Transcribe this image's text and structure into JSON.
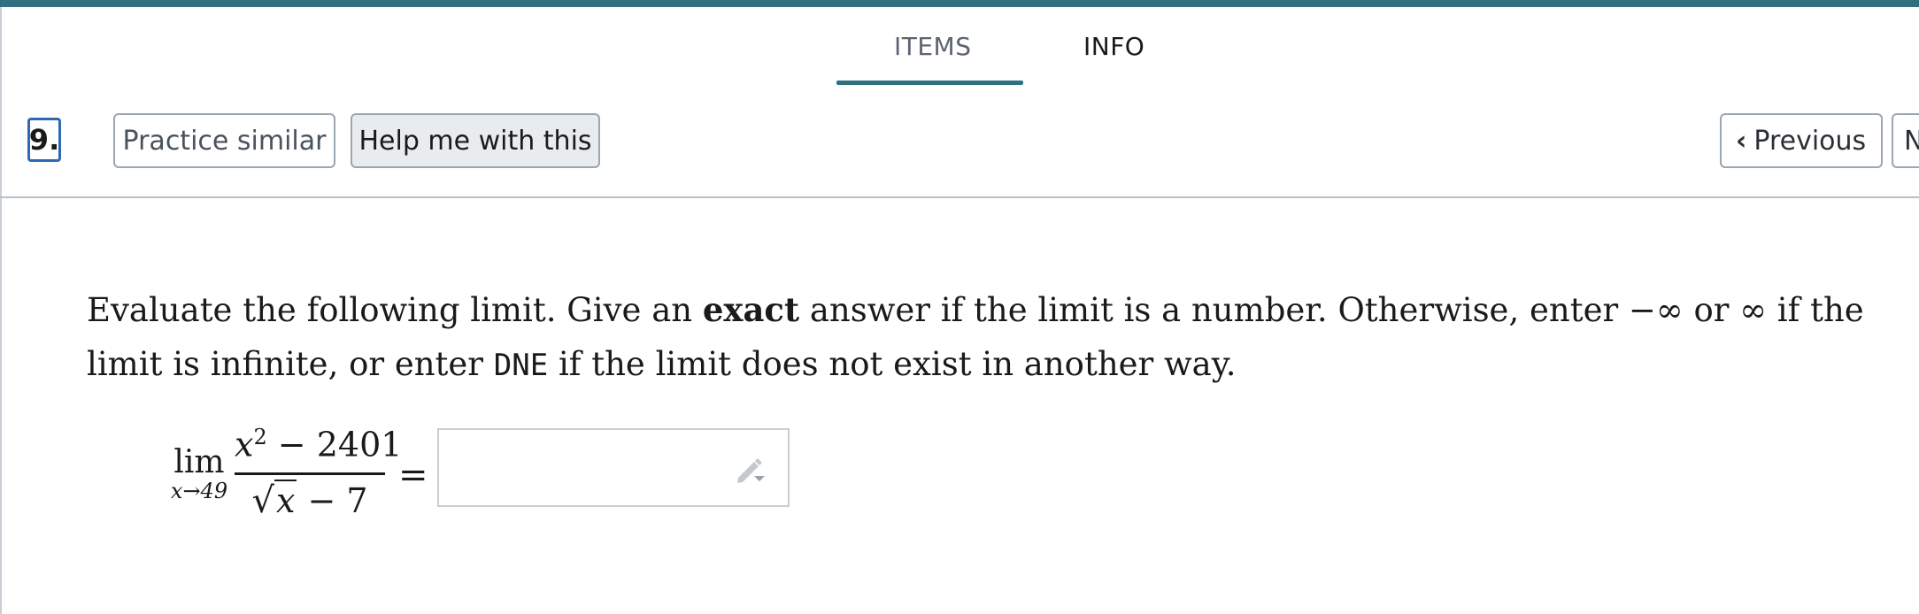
{
  "tabs": [
    {
      "label": "ITEMS",
      "active": true
    },
    {
      "label": "INFO",
      "active": false
    }
  ],
  "toolbar": {
    "question_number": "9.",
    "practice_similar_label": "Practice similar",
    "help_label": "Help me with this",
    "previous_label": "Previous",
    "next_label": "N"
  },
  "prompt": {
    "text_1": "Evaluate the following limit. Give an ",
    "bold": "exact",
    "text_2": " answer if the limit is a number. Otherwise, enter −∞ or ∞ if the limit is infinite, or enter ",
    "code": "DNE",
    "text_3": " if the limit does not exist in another way."
  },
  "math": {
    "lim": "lim",
    "subscript": "x→49",
    "numerator_var": "x",
    "numerator_exp": "2",
    "numerator_rest": " − 2401",
    "denominator_radicand": "x",
    "denominator_rest": " − 7",
    "equals": "="
  },
  "answer": {
    "value": "",
    "icon": "pencil-dropdown-icon"
  },
  "colors": {
    "accent": "#2f6f80",
    "question_outline": "#2f69b3",
    "border": "#b7c0ca"
  }
}
